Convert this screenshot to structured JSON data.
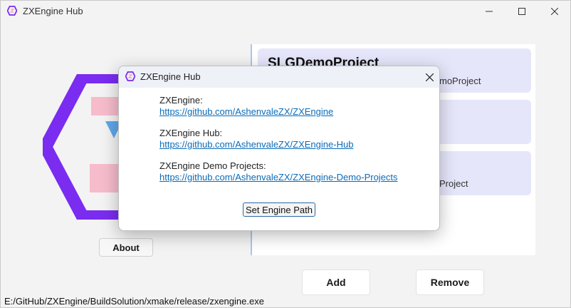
{
  "window": {
    "title": "ZXEngine Hub"
  },
  "controls": {
    "minimize": "—",
    "maximize": "☐",
    "close": "✕"
  },
  "left_panel": {
    "about_label": "About"
  },
  "projects": [
    {
      "title": "SLGDemoProject",
      "subtitle": "moProject"
    },
    {
      "title": "",
      "subtitle": ""
    },
    {
      "title": "",
      "subtitle": "Project"
    }
  ],
  "actions": {
    "add_label": "Add",
    "remove_label": "Remove"
  },
  "status": {
    "path": "E:/GitHub/ZXEngine/BuildSolution/xmake/release/zxengine.exe"
  },
  "dialog": {
    "title": "ZXEngine Hub",
    "close": "✕",
    "links": [
      {
        "label": "ZXEngine:",
        "url": "https://github.com/AshenvaleZX/ZXEngine"
      },
      {
        "label": "ZXEngine Hub:",
        "url": "https://github.com/AshenvaleZX/ZXEngine-Hub"
      },
      {
        "label": "ZXEngine Demo Projects:",
        "url": "https://github.com/AshenvaleZX/ZXEngine-Demo-Projects"
      }
    ],
    "set_engine_path_label": "Set Engine Path"
  },
  "icons": {
    "app": "zxengine-hex-icon",
    "logo": "zxengine-logo"
  },
  "colors": {
    "accent": "#0b6bb8",
    "logo_purple": "#7a2cf0",
    "card_bg": "#e6e6fb"
  }
}
